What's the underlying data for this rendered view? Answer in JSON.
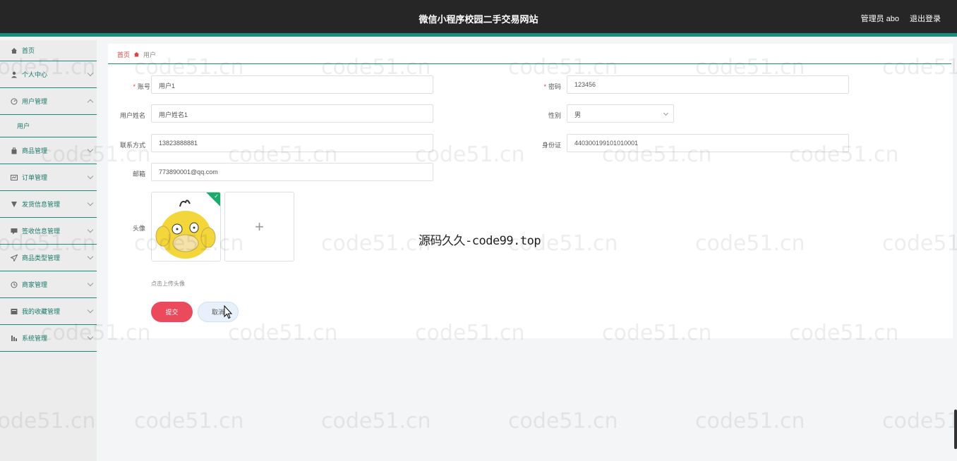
{
  "header": {
    "title": "微信小程序校园二手交易网站",
    "user": "管理员 abo",
    "logout": "退出登录"
  },
  "sidebar": {
    "items": [
      {
        "label": "首页",
        "icon": "home-icon"
      },
      {
        "label": "个人中心",
        "icon": "user-icon"
      },
      {
        "label": "用户管理",
        "icon": "gauge-icon",
        "sub": "用户"
      },
      {
        "label": "商品管理",
        "icon": "bag-icon"
      },
      {
        "label": "订单管理",
        "icon": "order-icon"
      },
      {
        "label": "发货信息管理",
        "icon": "shipping-icon"
      },
      {
        "label": "签收信息管理",
        "icon": "sign-icon"
      },
      {
        "label": "商品类型管理",
        "icon": "send-icon"
      },
      {
        "label": "商家管理",
        "icon": "clock-icon"
      },
      {
        "label": "我的收藏管理",
        "icon": "star-icon"
      },
      {
        "label": "系统管理",
        "icon": "settings-icon"
      }
    ]
  },
  "breadcrumb": {
    "home": "首页",
    "current": "用户"
  },
  "form": {
    "account": {
      "label": "账号",
      "value": "用户1"
    },
    "password": {
      "label": "密码",
      "value": "123456"
    },
    "name": {
      "label": "用户姓名",
      "value": "用户姓名1"
    },
    "gender": {
      "label": "性别",
      "value": "男"
    },
    "phone": {
      "label": "联系方式",
      "value": "13823888881"
    },
    "idcard": {
      "label": "身份证",
      "value": "440300199101010001"
    },
    "email": {
      "label": "邮箱",
      "value": "773890001@qq.com"
    },
    "avatar": {
      "label": "头像",
      "hint": "点击上传头像"
    },
    "submit": "提交",
    "cancel": "取消"
  },
  "overlay": "源码久久-code99.top",
  "watermark": "code51.cn",
  "colors": {
    "accent": "#1a8c7a",
    "danger": "#ea4a5c",
    "topbar": "#262626"
  }
}
